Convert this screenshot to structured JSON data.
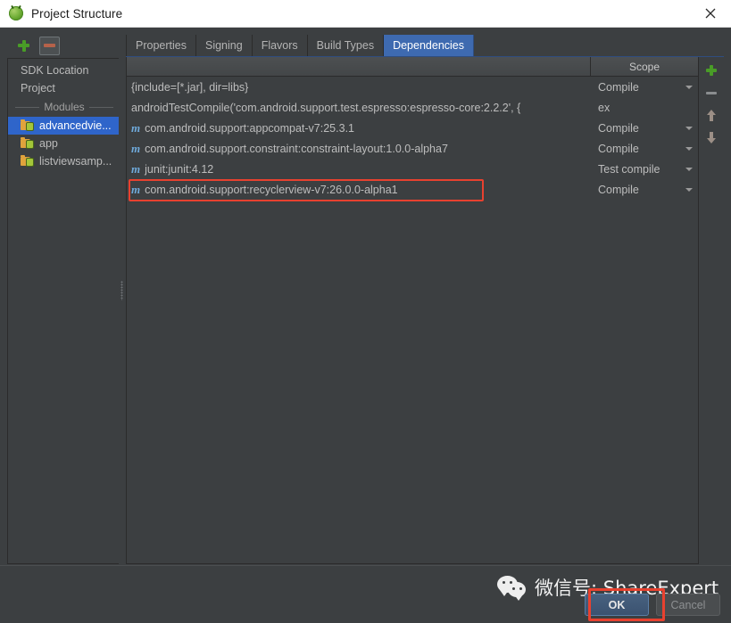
{
  "window": {
    "title": "Project Structure",
    "app_icon": "android-studio-icon",
    "close_icon": "close-icon"
  },
  "sidebar": {
    "toolbar": {
      "add_label": "+",
      "remove_label": "-"
    },
    "items": [
      {
        "label": "SDK Location",
        "type": "item",
        "selected": false
      },
      {
        "label": "Project",
        "type": "item",
        "selected": false
      },
      {
        "label": "Modules",
        "type": "separator",
        "selected": false
      },
      {
        "label": "advancedvie...",
        "type": "module",
        "selected": true
      },
      {
        "label": "app",
        "type": "module",
        "selected": false
      },
      {
        "label": "listviewsamp...",
        "type": "module",
        "selected": false
      }
    ]
  },
  "tabs": [
    {
      "label": "Properties",
      "active": false
    },
    {
      "label": "Signing",
      "active": false
    },
    {
      "label": "Flavors",
      "active": false
    },
    {
      "label": "Build Types",
      "active": false
    },
    {
      "label": "Dependencies",
      "active": true
    }
  ],
  "table": {
    "headers": [
      "",
      "Scope"
    ],
    "rows": [
      {
        "icon": "",
        "dependency": "{include=[*.jar], dir=libs}",
        "scope": "Compile",
        "has_caret": true,
        "overflow": "",
        "highlighted": false
      },
      {
        "icon": "",
        "dependency": "androidTestCompile('com.android.support.test.espresso:espresso-core:2.2.2', {",
        "scope": "",
        "has_caret": false,
        "overflow": "ex",
        "highlighted": false
      },
      {
        "icon": "m",
        "dependency": "com.android.support:appcompat-v7:25.3.1",
        "scope": "Compile",
        "has_caret": true,
        "overflow": "",
        "highlighted": false
      },
      {
        "icon": "m",
        "dependency": "com.android.support.constraint:constraint-layout:1.0.0-alpha7",
        "scope": "Compile",
        "has_caret": true,
        "overflow": "",
        "highlighted": false
      },
      {
        "icon": "m",
        "dependency": "junit:junit:4.12",
        "scope": "Test compile",
        "has_caret": true,
        "overflow": "",
        "highlighted": false
      },
      {
        "icon": "m",
        "dependency": "com.android.support:recyclerview-v7:26.0.0-alpha1",
        "scope": "Compile",
        "has_caret": true,
        "overflow": "",
        "highlighted": true
      }
    ]
  },
  "side_toolbar": {
    "add": "add-icon",
    "remove": "remove-icon",
    "move_up": "arrow-up-icon",
    "move_down": "arrow-down-icon"
  },
  "footer": {
    "ok_label": "OK",
    "cancel_label": "Cancel"
  },
  "watermark": {
    "logo": "wechat-icon",
    "text": "微信号: ShareExpert"
  },
  "colors": {
    "accent_blue": "#3e6ab0",
    "selection_blue": "#2f65ca",
    "annotation_red": "#e8412f",
    "panel_bg": "#3c3f41",
    "titlebar_bg": "#ffffff"
  }
}
